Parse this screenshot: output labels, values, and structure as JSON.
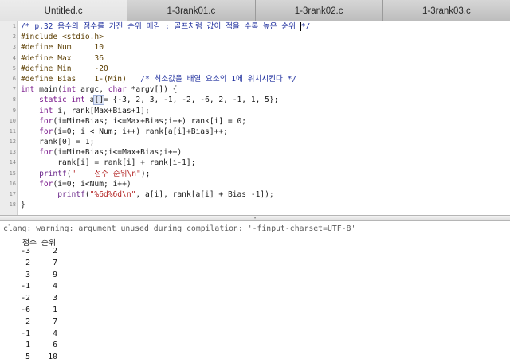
{
  "tabs": [
    {
      "label": "Untitled.c",
      "active": true
    },
    {
      "label": "1-3rank01.c",
      "active": false
    },
    {
      "label": "1-3rank02.c",
      "active": false
    },
    {
      "label": "1-3rank03.c",
      "active": false
    }
  ],
  "editor": {
    "lines": [
      {
        "n": "1",
        "parts": [
          [
            "cm",
            "/* p.32 음수의 점수를 가진 순위 매김 : 골프처럼 값이 적을 수록 높은 순위 "
          ],
          [
            "cursor",
            ""
          ],
          [
            "cm",
            "*/"
          ]
        ]
      },
      {
        "n": "2",
        "parts": [
          [
            "pp",
            "#include <stdio.h>"
          ]
        ]
      },
      {
        "n": "3",
        "parts": [
          [
            "pp",
            "#define Num     10"
          ]
        ]
      },
      {
        "n": "4",
        "parts": [
          [
            "pp",
            "#define Max     36"
          ]
        ]
      },
      {
        "n": "5",
        "parts": [
          [
            "pp",
            "#define Min     -20"
          ]
        ]
      },
      {
        "n": "6",
        "parts": [
          [
            "pp",
            "#define Bias    1-(Min)   "
          ],
          [
            "cm",
            "/* 최소값을 배열 요소의 1에 위치시킨다 */"
          ]
        ]
      },
      {
        "n": "7",
        "parts": [
          [
            "kw",
            "int"
          ],
          [
            "",
            " main("
          ],
          [
            "kw",
            "int"
          ],
          [
            "",
            " argc, "
          ],
          [
            "kw",
            "char"
          ],
          [
            "",
            " *argv[]) {"
          ]
        ]
      },
      {
        "n": "8",
        "parts": [
          [
            "",
            "    "
          ],
          [
            "kw",
            "static int"
          ],
          [
            "",
            " a"
          ],
          [
            "hl",
            "[]"
          ],
          [
            "",
            "= {-3, 2, 3, -1, -2, -6, 2, -1, 1, 5};"
          ]
        ]
      },
      {
        "n": "9",
        "parts": [
          [
            "",
            "    "
          ],
          [
            "kw",
            "int"
          ],
          [
            "",
            " i, rank[Max+Bias+1];"
          ]
        ]
      },
      {
        "n": "10",
        "parts": [
          [
            "",
            "    "
          ],
          [
            "kw",
            "for"
          ],
          [
            "",
            "(i=Min+Bias; i<=Max+Bias;i++) rank[i] = 0;"
          ]
        ]
      },
      {
        "n": "11",
        "parts": [
          [
            "",
            "    "
          ],
          [
            "kw",
            "for"
          ],
          [
            "",
            "(i=0; i < Num; i++) rank[a[i]+Bias]++;"
          ]
        ]
      },
      {
        "n": "12",
        "parts": [
          [
            "",
            "    rank[0] = 1;"
          ]
        ]
      },
      {
        "n": "13",
        "parts": [
          [
            "",
            "    "
          ],
          [
            "kw",
            "for"
          ],
          [
            "",
            "(i=Min+Bias;i<=Max+Bias;i++)"
          ]
        ]
      },
      {
        "n": "14",
        "parts": [
          [
            "",
            "        rank[i] = rank[i] + rank[i-1];"
          ]
        ]
      },
      {
        "n": "15",
        "parts": [
          [
            "",
            "    "
          ],
          [
            "fn",
            "printf"
          ],
          [
            "",
            "("
          ],
          [
            "str",
            "\"    점수 순위\\n\""
          ],
          [
            "",
            ");"
          ]
        ]
      },
      {
        "n": "16",
        "parts": [
          [
            "",
            "    "
          ],
          [
            "kw",
            "for"
          ],
          [
            "",
            "(i=0; i<Num; i++)"
          ]
        ]
      },
      {
        "n": "17",
        "parts": [
          [
            "",
            "        "
          ],
          [
            "fn",
            "printf"
          ],
          [
            "",
            "("
          ],
          [
            "str",
            "\"%6d%6d\\n\""
          ],
          [
            "",
            ", a[i], rank[a[i] + Bias -1]);"
          ]
        ]
      },
      {
        "n": "18",
        "parts": [
          [
            "",
            "}"
          ]
        ]
      }
    ]
  },
  "console": {
    "warning": "clang: warning: argument unused during compilation: '-finput-charset=UTF-8'",
    "header": "점수 순위",
    "rows": [
      {
        "score": "-3",
        "rank": "2"
      },
      {
        "score": "2",
        "rank": "7"
      },
      {
        "score": "3",
        "rank": "9"
      },
      {
        "score": "-1",
        "rank": "4"
      },
      {
        "score": "-2",
        "rank": "3"
      },
      {
        "score": "-6",
        "rank": "1"
      },
      {
        "score": "2",
        "rank": "7"
      },
      {
        "score": "-1",
        "rank": "4"
      },
      {
        "score": "1",
        "rank": "6"
      },
      {
        "score": "5",
        "rank": "10"
      }
    ]
  }
}
